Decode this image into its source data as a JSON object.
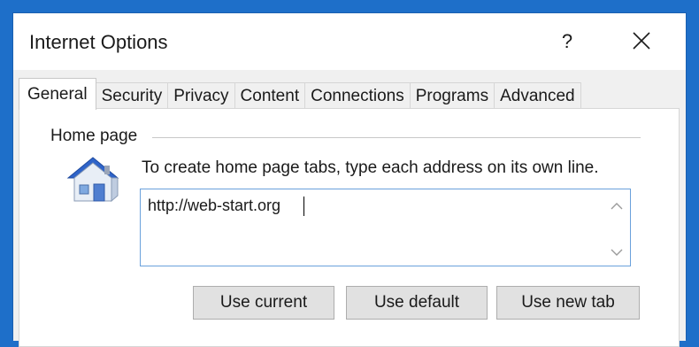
{
  "window": {
    "title": "Internet Options",
    "help_label": "?",
    "close_icon": "close-icon"
  },
  "tabs": [
    {
      "label": "General",
      "active": true
    },
    {
      "label": "Security",
      "active": false
    },
    {
      "label": "Privacy",
      "active": false
    },
    {
      "label": "Content",
      "active": false
    },
    {
      "label": "Connections",
      "active": false
    },
    {
      "label": "Programs",
      "active": false
    },
    {
      "label": "Advanced",
      "active": false
    }
  ],
  "home_page": {
    "group_label": "Home page",
    "icon": "house-icon",
    "instruction": "To create home page tabs, type each address on its own line.",
    "value": "http://web-start.org"
  },
  "buttons": {
    "use_current": "Use current",
    "use_default": "Use default",
    "use_new_tab": "Use new tab"
  },
  "colors": {
    "frame": "#1e6fc9",
    "input_border": "#6aa1dc",
    "button_bg": "#e1e1e1"
  }
}
